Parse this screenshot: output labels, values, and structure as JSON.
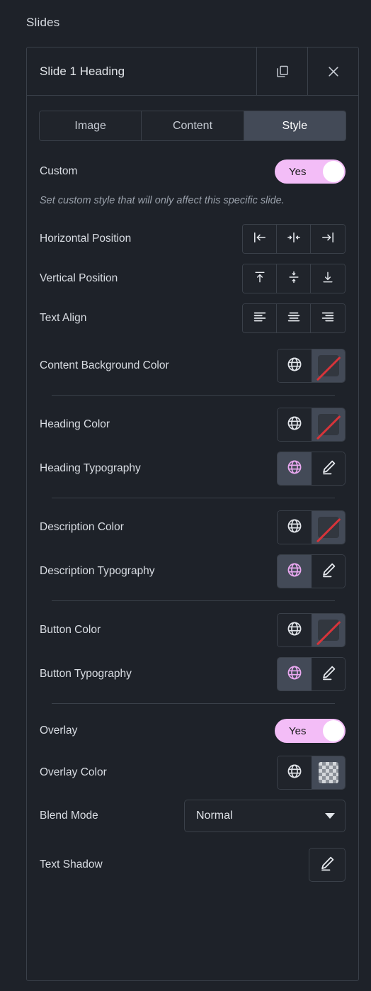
{
  "section": {
    "title": "Slides"
  },
  "slide": {
    "title": "Slide 1 Heading",
    "duplicate_icon": "duplicate-icon",
    "close_icon": "close-icon"
  },
  "tabs": [
    {
      "label": "Image",
      "active": false
    },
    {
      "label": "Content",
      "active": false
    },
    {
      "label": "Style",
      "active": true
    }
  ],
  "custom": {
    "label": "Custom",
    "value": "Yes",
    "hint": "Set custom style that will only affect this specific slide."
  },
  "horizontal_position": {
    "label": "Horizontal Position",
    "options": [
      "align-left-icon",
      "align-center-h-icon",
      "align-right-icon"
    ],
    "selected": null
  },
  "vertical_position": {
    "label": "Vertical Position",
    "options": [
      "align-top-icon",
      "align-middle-icon",
      "align-bottom-icon"
    ],
    "selected": null
  },
  "text_align": {
    "label": "Text Align",
    "options": [
      "text-align-left-icon",
      "text-align-center-icon",
      "text-align-right-icon"
    ],
    "selected": null
  },
  "content_background_color": {
    "label": "Content Background Color",
    "globe_active": false,
    "swatch": "none"
  },
  "heading_color": {
    "label": "Heading Color",
    "globe_active": false,
    "swatch": "none"
  },
  "heading_typography": {
    "label": "Heading Typography",
    "globe_active": true,
    "swatch": "edit"
  },
  "description_color": {
    "label": "Description Color",
    "globe_active": false,
    "swatch": "none"
  },
  "description_typography": {
    "label": "Description Typography",
    "globe_active": true,
    "swatch": "edit"
  },
  "button_color": {
    "label": "Button Color",
    "globe_active": false,
    "swatch": "none"
  },
  "button_typography": {
    "label": "Button Typography",
    "globe_active": true,
    "swatch": "edit"
  },
  "overlay": {
    "label": "Overlay",
    "value": "Yes"
  },
  "overlay_color": {
    "label": "Overlay Color",
    "globe_active": false,
    "swatch": "transparent"
  },
  "blend_mode": {
    "label": "Blend Mode",
    "value": "Normal"
  },
  "text_shadow": {
    "label": "Text Shadow",
    "edit_icon": "pencil-icon"
  },
  "colors": {
    "background": "#1e2229",
    "panel_border": "#3a4049",
    "accent_toggle": "#f3bdf7",
    "active_tab": "#434a57",
    "globe_active": "#e9a8f0",
    "no_color_slash": "#d6343a",
    "text_primary": "#d9dde3",
    "text_muted": "#9aa1ab"
  }
}
